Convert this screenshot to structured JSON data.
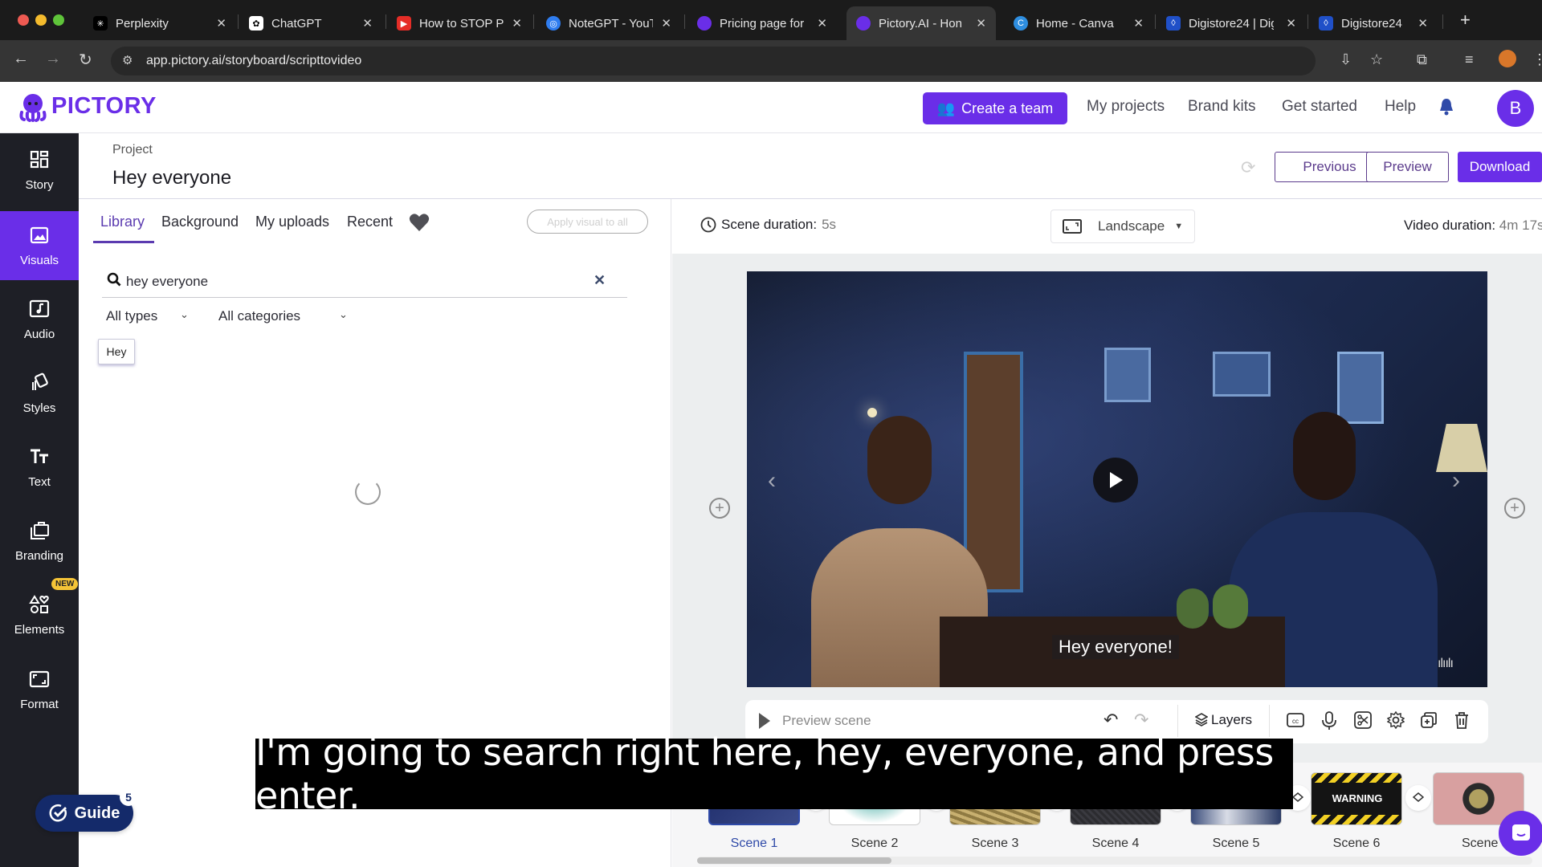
{
  "browser": {
    "tabs": [
      {
        "label": "Perplexity",
        "icon": "perplexity-icon",
        "favicon_color": "#000000"
      },
      {
        "label": "ChatGPT",
        "icon": "chatgpt-icon",
        "favicon_color": "#ffffff"
      },
      {
        "label": "How to STOP Pr",
        "icon": "youtube-icon",
        "favicon_color": "#e52d27"
      },
      {
        "label": "NoteGPT - YouT",
        "icon": "notegpt-icon",
        "favicon_color": "#2f7df0"
      },
      {
        "label": "Pricing page for",
        "icon": "pictory-icon",
        "favicon_color": "#6a2ee8"
      },
      {
        "label": "Pictory.AI - Hon",
        "icon": "pictory-icon",
        "favicon_color": "#6a2ee8",
        "active": true
      },
      {
        "label": "Home - Canva",
        "icon": "canva-icon",
        "favicon_color": "#2e8ee0"
      },
      {
        "label": "Digistore24 | Dig",
        "icon": "digistore-icon",
        "favicon_color": "#2050c8"
      },
      {
        "label": "Digistore24",
        "icon": "digistore-icon",
        "favicon_color": "#2050c8"
      }
    ],
    "close_glyph": "✕",
    "new_tab_glyph": "+",
    "url": "app.pictory.ai/storyboard/scripttovideo"
  },
  "header": {
    "logo": "PICTORY",
    "create_team": "Create a team",
    "nav": [
      "My projects",
      "Brand kits",
      "Get started",
      "Help"
    ],
    "avatar_initial": "B",
    "brand_color": "#6a2ee8"
  },
  "sidebar": {
    "items": [
      {
        "label": "Story",
        "icon": "story-icon"
      },
      {
        "label": "Visuals",
        "icon": "visuals-icon",
        "active": true
      },
      {
        "label": "Audio",
        "icon": "audio-icon"
      },
      {
        "label": "Styles",
        "icon": "styles-icon"
      },
      {
        "label": "Text",
        "icon": "text-icon"
      },
      {
        "label": "Branding",
        "icon": "branding-icon"
      },
      {
        "label": "Elements",
        "icon": "elements-icon",
        "badge": "NEW"
      },
      {
        "label": "Format",
        "icon": "format-icon"
      }
    ]
  },
  "project": {
    "label": "Project",
    "title": "Hey everyone",
    "buttons": {
      "previous": "Previous",
      "preview": "Preview",
      "download": "Download"
    }
  },
  "visuals_panel": {
    "tabs": [
      "Library",
      "Background",
      "My uploads",
      "Recent"
    ],
    "active_tab": "Library",
    "apply_all": "Apply visual to all",
    "search": {
      "value": "hey everyone",
      "placeholder": ""
    },
    "filters": {
      "type": "All types",
      "category": "All categories"
    },
    "suggestion_chip": "Hey",
    "loading": true
  },
  "editor": {
    "scene_duration_label": "Scene duration:",
    "scene_duration_value": "5s",
    "orientation": "Landscape",
    "video_duration_label": "Video duration:",
    "video_duration_value": "4m 17s",
    "video_caption": "Hey everyone!",
    "toolbar": {
      "preview_scene": "Preview scene",
      "layers": "Layers",
      "icons": [
        "cc-icon",
        "microphone-icon",
        "scissors-icon",
        "settings-icon",
        "duplicate-icon",
        "trash-icon"
      ]
    }
  },
  "scenes": [
    {
      "label": "Scene 1",
      "active": true
    },
    {
      "label": "Scene 2"
    },
    {
      "label": "Scene 3"
    },
    {
      "label": "Scene 4"
    },
    {
      "label": "Scene 5"
    },
    {
      "label": "Scene 6",
      "thumb_text": "WARNING"
    },
    {
      "label": "Scene"
    }
  ],
  "overlay_caption": "I'm going to search right here, hey, everyone, and press enter.",
  "guide": {
    "label": "Guide",
    "count": "5"
  }
}
